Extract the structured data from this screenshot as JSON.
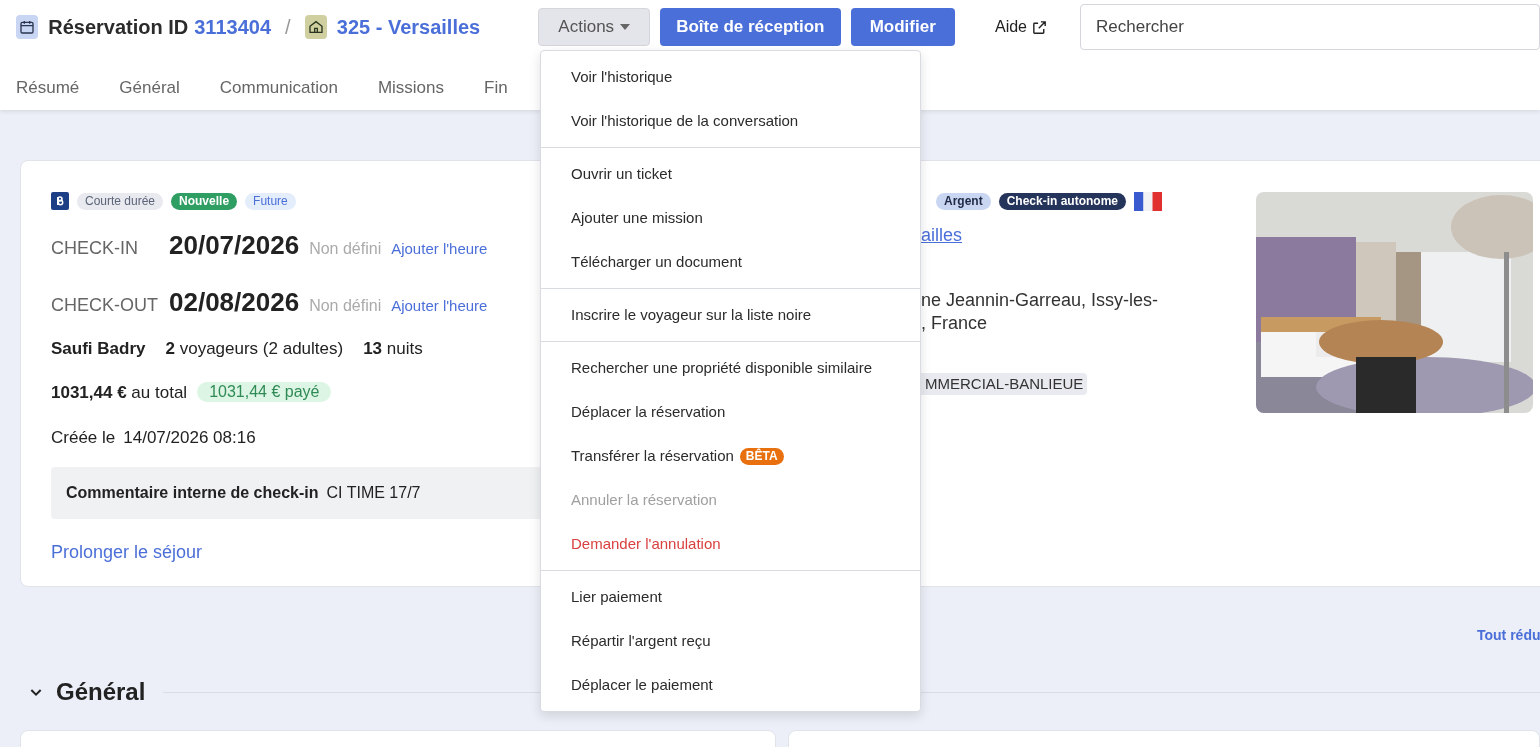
{
  "header": {
    "title": "Réservation ID",
    "reservation_id": "3113404",
    "separator": "/",
    "property": "325 - Versailles"
  },
  "actions": {
    "label": "Actions",
    "expanded": true
  },
  "buttons": [
    "Boîte de réception",
    "Modifier"
  ],
  "help": "Aide",
  "search": {
    "placeholder": "Rechercher"
  },
  "tabs": [
    "Résumé",
    "Général",
    "Communication",
    "Missions",
    "Fin"
  ],
  "menu": {
    "groups": [
      [
        {
          "label": "Voir l'historique",
          "kind": "normal"
        },
        {
          "label": "Voir l'historique de la conversation",
          "kind": "normal"
        }
      ],
      [
        {
          "label": "Ouvrir un ticket",
          "kind": "normal"
        },
        {
          "label": "Ajouter une mission",
          "kind": "normal"
        },
        {
          "label": "Télécharger un document",
          "kind": "normal"
        }
      ],
      [
        {
          "label": "Inscrire le voyageur sur la liste noire",
          "kind": "normal"
        }
      ],
      [
        {
          "label": "Rechercher une propriété disponible similaire",
          "kind": "normal"
        },
        {
          "label": "Déplacer la réservation",
          "kind": "normal"
        },
        {
          "label": "Transférer la réservation",
          "kind": "normal",
          "badge": "BÊTA"
        },
        {
          "label": "Annuler la réservation",
          "kind": "disabled"
        },
        {
          "label": "Demander l'annulation",
          "kind": "danger"
        }
      ],
      [
        {
          "label": "Lier paiement",
          "kind": "normal"
        },
        {
          "label": "Répartir l'argent reçu",
          "kind": "normal"
        },
        {
          "label": "Déplacer le paiement",
          "kind": "normal"
        }
      ]
    ]
  },
  "booking": {
    "tags": [
      {
        "label": "Courte durée",
        "kind": "neutral"
      },
      {
        "label": "Nouvelle",
        "kind": "success"
      },
      {
        "label": "Future",
        "kind": "info"
      }
    ],
    "dates": [
      {
        "label": "CHECK-IN",
        "date": "20/07/2026",
        "time": "Non défini",
        "action": "Ajouter l'heure"
      },
      {
        "label": "CHECK-OUT",
        "date": "02/08/2026",
        "time": "Non défini",
        "action": "Ajouter l'heure"
      }
    ],
    "guest": "Saufi Badry",
    "travelers": "**2** voyageurs (2 adultes)",
    "nights": "**13** nuits",
    "total": "**1031,44 €** au total",
    "paid": "1031,44 € payé",
    "created_label": "Créée le",
    "created": "14/07/2026 08:16",
    "comment_label": "Commentaire interne de check-in",
    "comment": "CI TIME 17/7",
    "extend": "Prolonger le séjour"
  },
  "property": {
    "tags": [
      {
        "label": "Argent",
        "kind": "light"
      },
      {
        "label": "Check-in autonome",
        "kind": "dark"
      }
    ],
    "link": "ailles",
    "address_lines": [
      "ne Jeannin-Garreau, Issy-les-",
      ", France"
    ],
    "zone": "MMERCIAL-BANLIEUE",
    "photo": {
      "kind": "picture"
    }
  },
  "collapse_all": "Tout rédu",
  "section": {
    "title": "Général",
    "expanded": true
  }
}
